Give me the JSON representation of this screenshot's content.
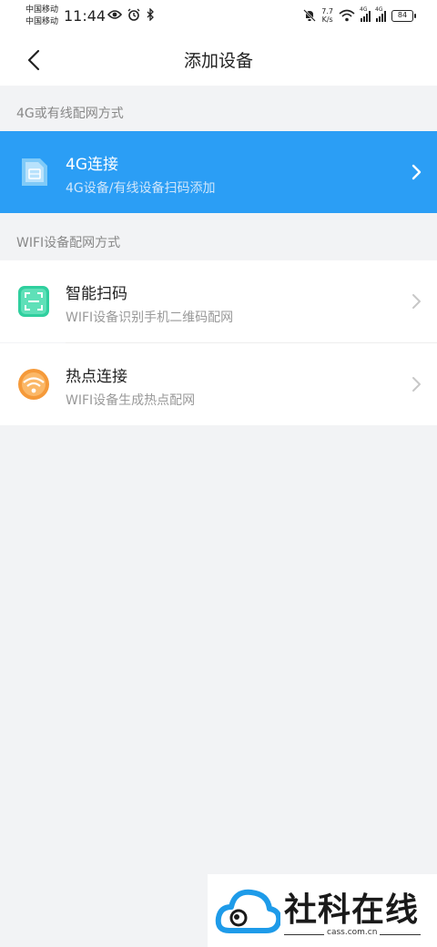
{
  "status_bar": {
    "carrier1": "中国移动",
    "carrier2": "中国移动",
    "time": "11:44",
    "net_speed_value": "7.7",
    "net_speed_unit": "K/s",
    "signal1_tag": "4G",
    "signal2_tag": "4G",
    "battery": "84"
  },
  "header": {
    "title": "添加设备",
    "back_icon": "chevron-left-icon"
  },
  "sections": [
    {
      "label": "4G或有线配网方式",
      "items": [
        {
          "title": "4G连接",
          "subtitle": "4G设备/有线设备扫码添加",
          "icon": "sim-card-icon",
          "active": true
        }
      ]
    },
    {
      "label": "WIFI设备配网方式",
      "items": [
        {
          "title": "智能扫码",
          "subtitle": "WIFI设备识别手机二维码配网",
          "icon": "scan-icon",
          "active": false
        },
        {
          "title": "热点连接",
          "subtitle": "WIFI设备生成热点配网",
          "icon": "wifi-hotspot-icon",
          "active": false
        }
      ]
    }
  ],
  "watermark": {
    "name": "社科在线",
    "domain": "cass.com.cn"
  },
  "colors": {
    "accent": "#2b9ef5",
    "background": "#f2f3f5",
    "scan_icon": "#2fcf9e",
    "hotspot_icon": "#f59a3a"
  }
}
